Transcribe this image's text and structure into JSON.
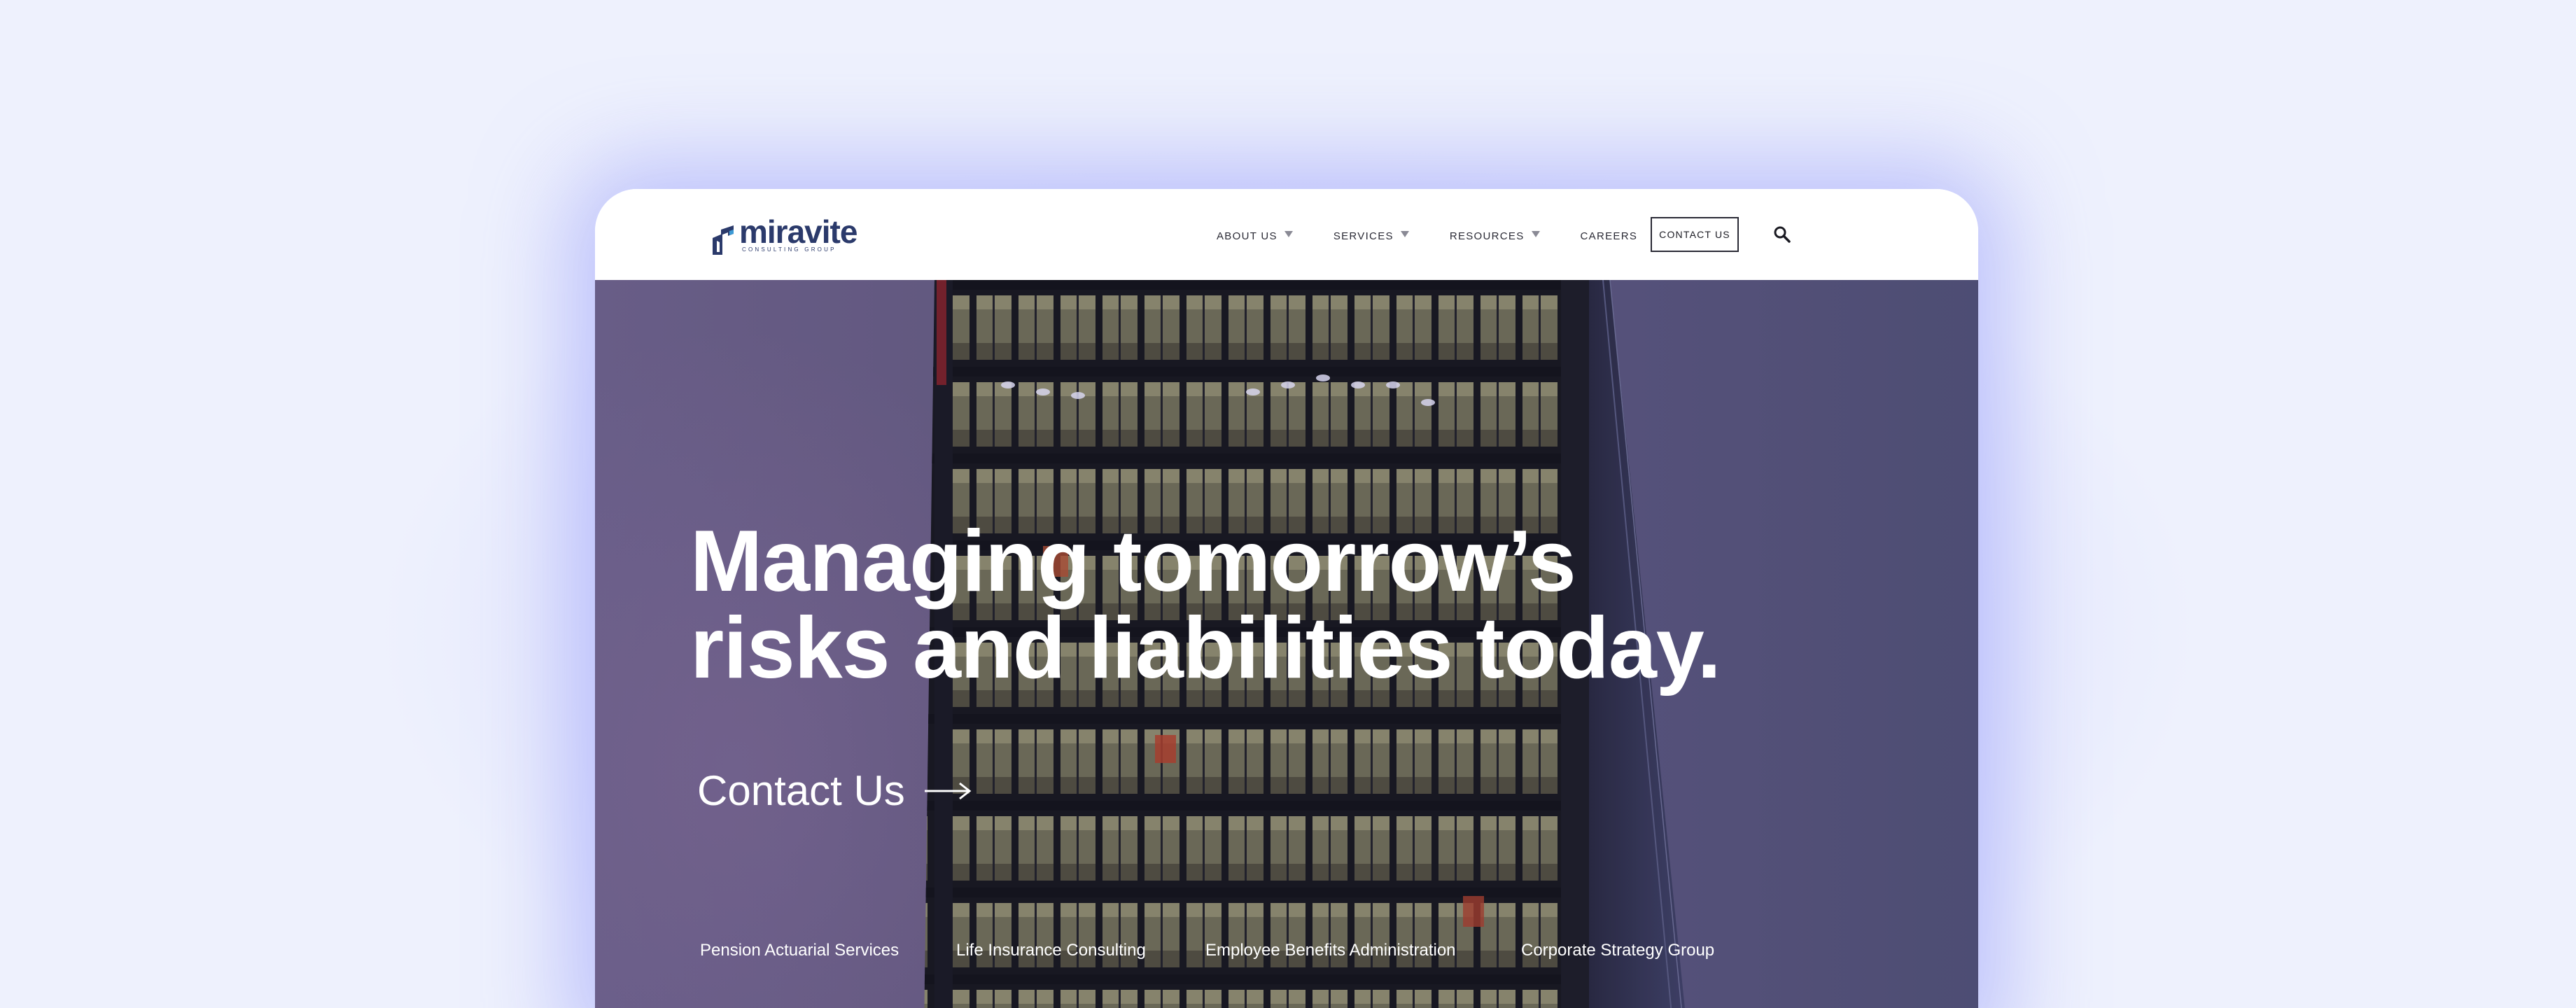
{
  "logo": {
    "word": "miravite",
    "sub": "Consulting Group"
  },
  "nav": {
    "items": [
      {
        "label": "ABOUT US",
        "has_dropdown": true
      },
      {
        "label": "SERVICES",
        "has_dropdown": true
      },
      {
        "label": "RESOURCES",
        "has_dropdown": true
      },
      {
        "label": "CAREERS",
        "has_dropdown": false
      }
    ],
    "contact_label": "CONTACT US",
    "search_icon": "search-icon"
  },
  "hero": {
    "headline_line1": "Managing tomorrow’s",
    "headline_line2": "risks and liabilities today.",
    "cta_label": "Contact Us",
    "cta_icon": "arrow-right-icon",
    "services": [
      "Pension Actuarial Services",
      "Life Insurance Consulting",
      "Employee Benefits Administration",
      "Corporate Strategy Group"
    ]
  },
  "colors": {
    "page_background": "#eef1fd",
    "glow": "#c9cdfb",
    "brand_navy": "#2b3a6b",
    "hero_overlay": "#63597f",
    "text_light": "#ffffff"
  }
}
